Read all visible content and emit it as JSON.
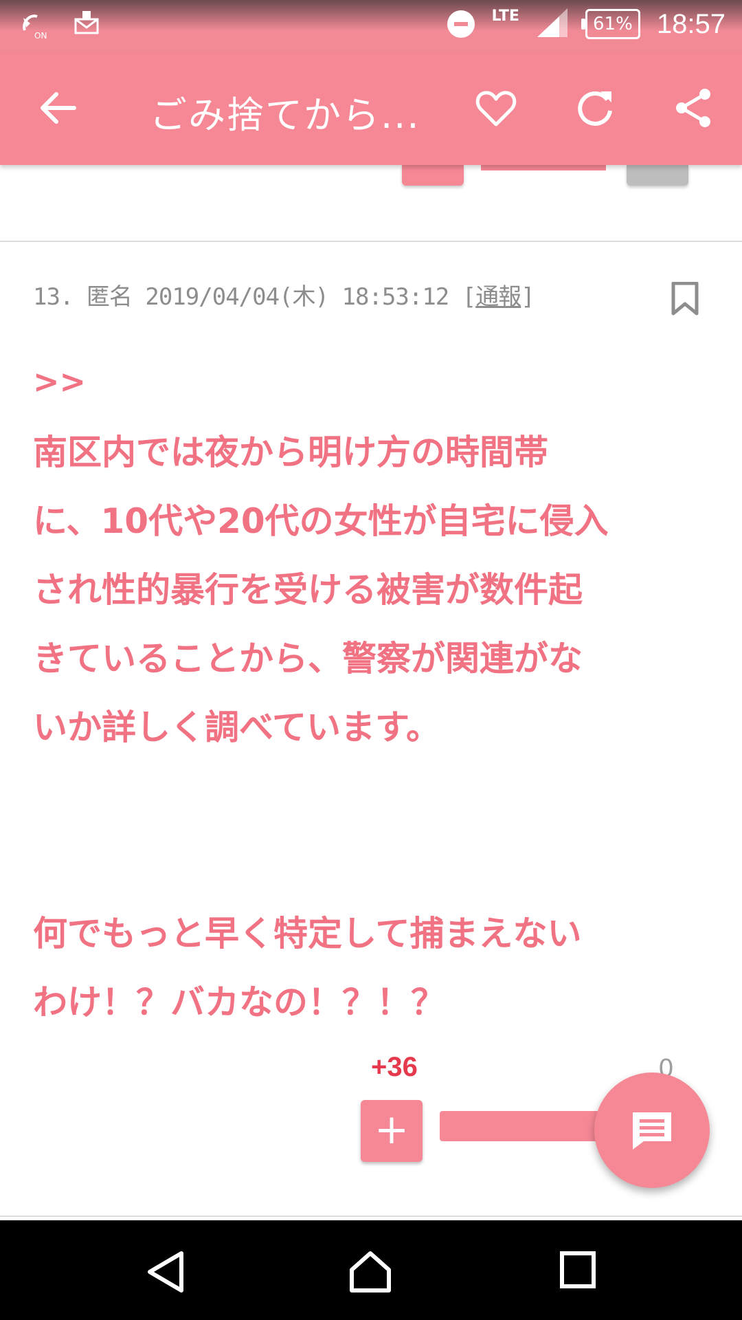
{
  "status_bar": {
    "time": "18:57",
    "network": "LTE",
    "battery": "61%",
    "icons": [
      "volte-on-icon",
      "mail-icon",
      "do-not-disturb-icon",
      "signal-icon",
      "battery-icon"
    ]
  },
  "app_bar": {
    "title": "ごみ捨てから...",
    "icons": [
      "back-arrow-icon",
      "heart-icon",
      "refresh-icon",
      "share-icon"
    ]
  },
  "comment": {
    "number": "13.",
    "author": "匿名",
    "datetime": "2019/04/04(木) 18:53:12",
    "report_open": "[",
    "report_label": "通報",
    "report_close": "]",
    "quote_marker": ">>",
    "paragraph1": "南区内では夜から明け方の時間帯\nに、10代や20代の女性が自宅に侵入\nされ性的暴行を受ける被害が数件起\nきていることから、警察が関連がな\nいか詳しく調べています。",
    "paragraph2": "何でもっと早く特定して捕まえない\nわけ！？バカなの！？！？",
    "plus_votes": "+36",
    "minus_votes": "0",
    "plus_button": "+"
  },
  "colors": {
    "accent": "#f68895",
    "text_pink": "#f07283",
    "vote_red": "#e53a4d"
  }
}
